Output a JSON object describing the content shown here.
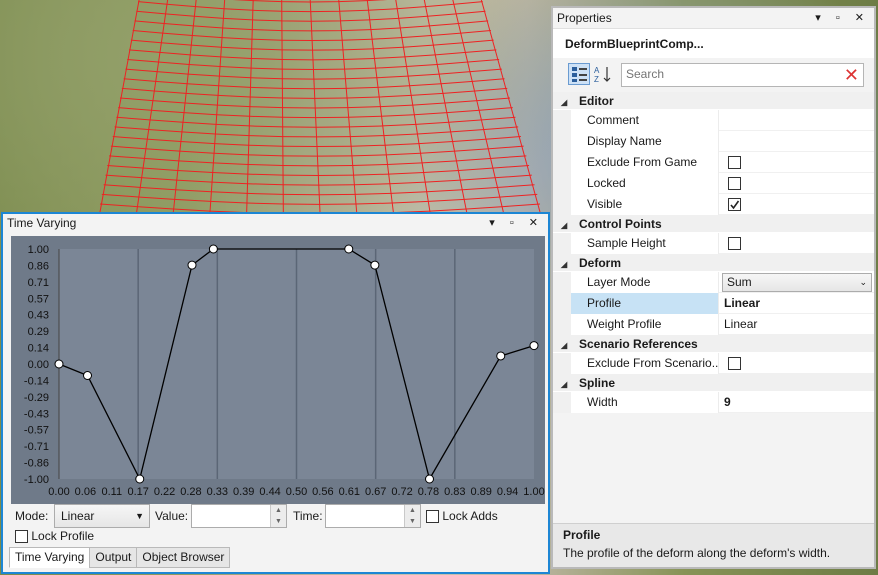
{
  "properties": {
    "title": "Properties",
    "window_controls": "▾ ▫ ✕",
    "object_name": "DeformBlueprintComp...",
    "search_placeholder": "Search",
    "categories": [
      {
        "label": "Editor",
        "rows": [
          {
            "name": "Comment",
            "value": "",
            "type": "text"
          },
          {
            "name": "Display Name",
            "value": "",
            "type": "text"
          },
          {
            "name": "Exclude From Game",
            "checked": false,
            "type": "checkbox"
          },
          {
            "name": "Locked",
            "checked": false,
            "type": "checkbox"
          },
          {
            "name": "Visible",
            "checked": true,
            "type": "checkbox"
          }
        ]
      },
      {
        "label": "Control Points",
        "rows": [
          {
            "name": "Sample Height",
            "checked": false,
            "type": "checkbox"
          }
        ]
      },
      {
        "label": "Deform",
        "rows": [
          {
            "name": "Layer Mode",
            "value": "Sum",
            "type": "combo"
          },
          {
            "name": "Profile",
            "value": "Linear",
            "type": "text",
            "bold": true,
            "selected": true
          },
          {
            "name": "Weight Profile",
            "value": "Linear",
            "type": "text"
          }
        ]
      },
      {
        "label": "Scenario References",
        "rows": [
          {
            "name": "Exclude From Scenario...",
            "checked": false,
            "type": "checkbox"
          }
        ]
      },
      {
        "label": "Spline",
        "rows": [
          {
            "name": "Width",
            "value": "9",
            "type": "text",
            "bold": true
          }
        ]
      }
    ],
    "description": {
      "title": "Profile",
      "text": "The profile of the deform along the deform's width."
    }
  },
  "time_varying": {
    "title": "Time Varying",
    "window_controls": "▾ ▫ ✕",
    "mode_label": "Mode:",
    "mode_value": "Linear",
    "value_label": "Value:",
    "value_value": "",
    "time_label": "Time:",
    "time_value": "",
    "lock_adds_label": "Lock Adds",
    "lock_profile_label": "Lock Profile",
    "tabs": [
      "Time Varying",
      "Output",
      "Object Browser"
    ],
    "active_tab": 0
  },
  "chart_data": {
    "type": "line",
    "x_ticks": [
      "0.00",
      "0.06",
      "0.11",
      "0.17",
      "0.22",
      "0.28",
      "0.33",
      "0.39",
      "0.44",
      "0.50",
      "0.56",
      "0.61",
      "0.67",
      "0.72",
      "0.78",
      "0.83",
      "0.89",
      "0.94",
      "1.00"
    ],
    "y_ticks": [
      "1.00",
      "0.86",
      "0.71",
      "0.57",
      "0.43",
      "0.29",
      "0.14",
      "0.00",
      "-0.14",
      "-0.29",
      "-0.43",
      "-0.57",
      "-0.71",
      "-0.86",
      "-1.00"
    ],
    "xlim": [
      0,
      1
    ],
    "ylim": [
      -1,
      1
    ],
    "grid": true,
    "points": [
      {
        "x": 0.0,
        "y": 0.0
      },
      {
        "x": 0.06,
        "y": -0.1
      },
      {
        "x": 0.17,
        "y": -1.0
      },
      {
        "x": 0.28,
        "y": 0.86
      },
      {
        "x": 0.325,
        "y": 1.0
      },
      {
        "x": 0.61,
        "y": 1.0
      },
      {
        "x": 0.665,
        "y": 0.86
      },
      {
        "x": 0.78,
        "y": -1.0
      },
      {
        "x": 0.93,
        "y": 0.07
      },
      {
        "x": 1.0,
        "y": 0.16
      }
    ],
    "colors": {
      "plot_bg": "#7b8696",
      "line": "#000000",
      "grid": "#5b6676",
      "point_fill": "#ffffff"
    }
  }
}
